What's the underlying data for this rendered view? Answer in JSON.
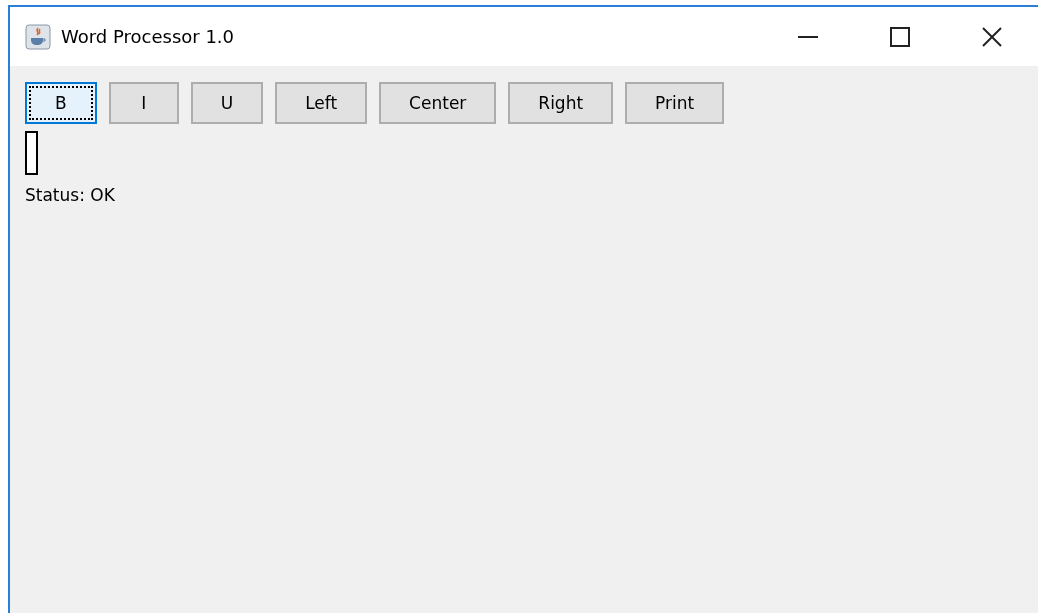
{
  "window": {
    "title": "Word Processor 1.0"
  },
  "toolbar": [
    {
      "label": "B",
      "focused": true
    },
    {
      "label": "I",
      "focused": false
    },
    {
      "label": "U",
      "focused": false
    },
    {
      "label": "Left",
      "focused": false
    },
    {
      "label": "Center",
      "focused": false
    },
    {
      "label": "Right",
      "focused": false
    },
    {
      "label": "Print",
      "focused": false
    }
  ],
  "status": "Status: OK"
}
